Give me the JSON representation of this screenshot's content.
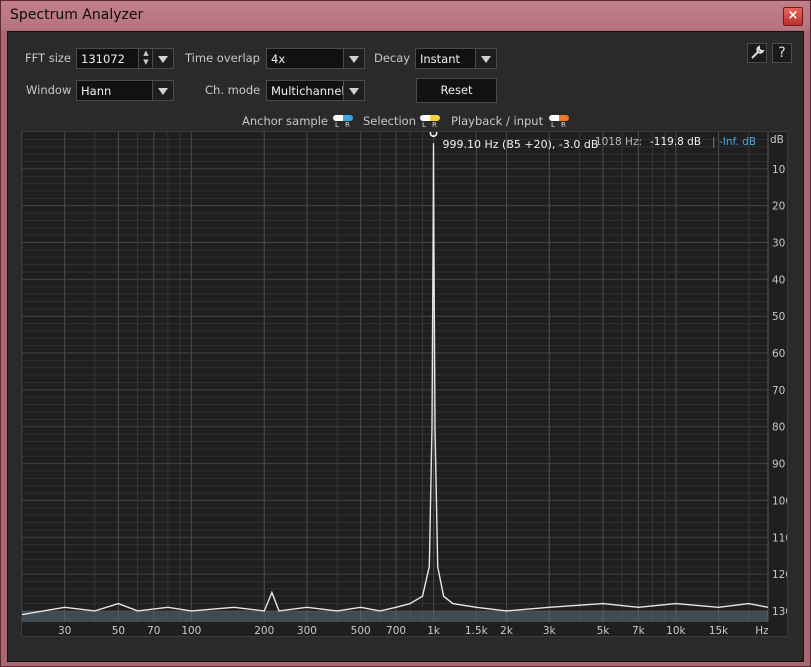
{
  "window": {
    "title": "Spectrum Analyzer",
    "close_symbol": "×"
  },
  "controls": {
    "fft_size": {
      "label": "FFT size",
      "value": "131072"
    },
    "time_overlap": {
      "label": "Time overlap",
      "value": "4x"
    },
    "decay": {
      "label": "Decay",
      "value": "Instant"
    },
    "window_fn": {
      "label": "Window",
      "value": "Hann"
    },
    "ch_mode": {
      "label": "Ch. mode",
      "value": "Multichannel"
    },
    "reset_label": "Reset",
    "help_symbol": "?"
  },
  "legend": {
    "anchor": "Anchor sample",
    "selection": "Selection",
    "playback": "Playback / input",
    "l": "L",
    "r": "R",
    "colors": {
      "anchor_l": "#ffffff",
      "anchor_r": "#3aa6e0",
      "selection_l": "#ffffff",
      "selection_r": "#f3d43c",
      "playback_l": "#ffffff",
      "playback_r": "#f07a24"
    }
  },
  "readout": {
    "freq": "1018 Hz:",
    "left_db": "-119.8 dB",
    "sep": "|",
    "right_db": "-Inf. dB"
  },
  "peak_label": "999.10 Hz (B5 +20), -3.0 dB",
  "chart_data": {
    "type": "line",
    "x_scale": "log",
    "y_unit": "dB",
    "xlim": [
      20,
      24000
    ],
    "ylim": [
      -133,
      0
    ],
    "x_ticks": [
      {
        "v": 30,
        "t": "30"
      },
      {
        "v": 50,
        "t": "50"
      },
      {
        "v": 70,
        "t": "70"
      },
      {
        "v": 100,
        "t": "100"
      },
      {
        "v": 200,
        "t": "200"
      },
      {
        "v": 300,
        "t": "300"
      },
      {
        "v": 500,
        "t": "500"
      },
      {
        "v": 700,
        "t": "700"
      },
      {
        "v": 1000,
        "t": "1k"
      },
      {
        "v": 1500,
        "t": "1.5k"
      },
      {
        "v": 2000,
        "t": "2k"
      },
      {
        "v": 3000,
        "t": "3k"
      },
      {
        "v": 5000,
        "t": "5k"
      },
      {
        "v": 7000,
        "t": "7k"
      },
      {
        "v": 10000,
        "t": "10k"
      },
      {
        "v": 15000,
        "t": "15k"
      }
    ],
    "x_unit": "Hz",
    "y_ticks": [
      {
        "v": -10,
        "t": "10"
      },
      {
        "v": -20,
        "t": "20"
      },
      {
        "v": -30,
        "t": "30"
      },
      {
        "v": -40,
        "t": "40"
      },
      {
        "v": -50,
        "t": "50"
      },
      {
        "v": -60,
        "t": "60"
      },
      {
        "v": -70,
        "t": "70"
      },
      {
        "v": -80,
        "t": "80"
      },
      {
        "v": -90,
        "t": "90"
      },
      {
        "v": -100,
        "t": "100"
      },
      {
        "v": -110,
        "t": "110"
      },
      {
        "v": -120,
        "t": "120"
      },
      {
        "v": -130,
        "t": "130"
      }
    ],
    "series": [
      {
        "color": "#e6e6e6",
        "points": [
          [
            20,
            -131
          ],
          [
            30,
            -129
          ],
          [
            40,
            -130
          ],
          [
            50,
            -128
          ],
          [
            60,
            -130
          ],
          [
            80,
            -129
          ],
          [
            100,
            -130
          ],
          [
            150,
            -129
          ],
          [
            200,
            -130
          ],
          [
            215,
            -125
          ],
          [
            230,
            -130
          ],
          [
            300,
            -129
          ],
          [
            400,
            -130
          ],
          [
            500,
            -129
          ],
          [
            600,
            -130
          ],
          [
            700,
            -129
          ],
          [
            800,
            -128
          ],
          [
            900,
            -126
          ],
          [
            960,
            -118
          ],
          [
            985,
            -80
          ],
          [
            995,
            -30
          ],
          [
            999.1,
            -3
          ],
          [
            1003,
            -30
          ],
          [
            1013,
            -80
          ],
          [
            1040,
            -118
          ],
          [
            1100,
            -126
          ],
          [
            1200,
            -128
          ],
          [
            1500,
            -129
          ],
          [
            2000,
            -130
          ],
          [
            3000,
            -129
          ],
          [
            5000,
            -128
          ],
          [
            7000,
            -129
          ],
          [
            10000,
            -128
          ],
          [
            15000,
            -129
          ],
          [
            20000,
            -128
          ],
          [
            24000,
            -129
          ]
        ]
      }
    ],
    "peak": {
      "x": 999.1,
      "y": -3.0
    }
  }
}
